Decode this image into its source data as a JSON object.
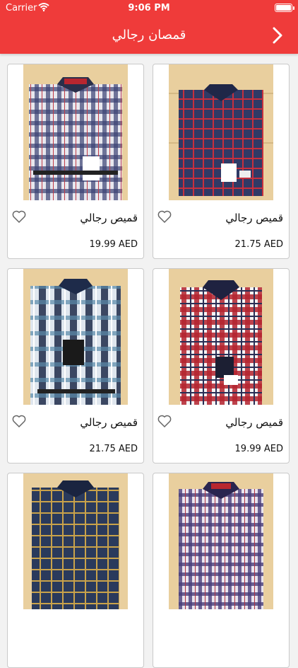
{
  "status": {
    "carrier": "Carrier",
    "time": "9:06 PM",
    "battery_level": 1.0
  },
  "header": {
    "title": "قمصان رجالي",
    "back_icon": "chevron-right-icon"
  },
  "colors": {
    "accent": "#ef3b3a"
  },
  "products": [
    {
      "name": "قميص رجالي",
      "price": "21.75 AED"
    },
    {
      "name": "قميص رجالي",
      "price": "19.99 AED"
    },
    {
      "name": "قميص رجالي",
      "price": "19.99 AED"
    },
    {
      "name": "قميص رجالي",
      "price": "21.75 AED"
    },
    {
      "name": "",
      "price": ""
    },
    {
      "name": "",
      "price": ""
    }
  ]
}
